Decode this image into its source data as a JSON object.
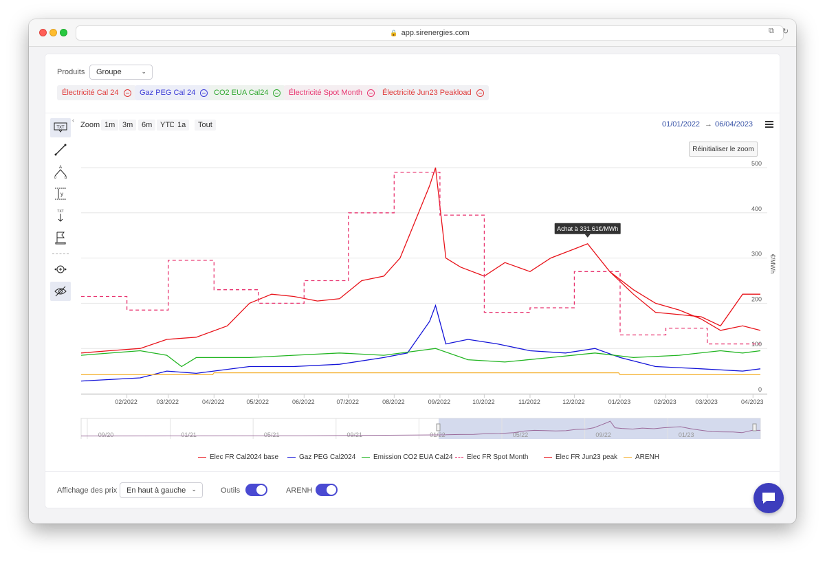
{
  "browser": {
    "url": "app.sirenergies.com"
  },
  "filters": {
    "products_label": "Produits",
    "group_value": "Groupe",
    "tags": [
      {
        "label": "Électricité Cal 24",
        "color": "#e03a3a",
        "bg": "#f1f1f4"
      },
      {
        "label": "Gaz PEG Cal 24",
        "color": "#3a3ad6",
        "bg": "#eceef8"
      },
      {
        "label": "CO2 EUA Cal24",
        "color": "#2fa82f",
        "bg": "#eef3ee"
      },
      {
        "label": "Électricité Spot Month",
        "color": "#e8336f",
        "bg": "#f5eef1"
      },
      {
        "label": "Électricité Jun23 Peakload",
        "color": "#e03a3a",
        "bg": "#f1f1f4"
      }
    ]
  },
  "toolbar": {
    "zoom_label": "Zoom",
    "zoom_buttons": [
      "1m",
      "3m",
      "6m",
      "YTD",
      "1a",
      "Tout"
    ],
    "range_from": "01/01/2022",
    "range_arrow": "→",
    "range_to": "06/04/2023",
    "reset_zoom": "Réinitialiser le zoom",
    "tools": [
      "text-label-icon",
      "line-icon",
      "triangle-abc-icon",
      "measure-y-icon",
      "text-arrow-icon",
      "flag-icon",
      "zoom-pan-icon",
      "hide-eye-icon"
    ]
  },
  "chart_data": {
    "type": "line",
    "x_ticks": [
      "02/2022",
      "03/2022",
      "04/2022",
      "05/2022",
      "06/2022",
      "07/2022",
      "08/2022",
      "09/2022",
      "10/2022",
      "11/2022",
      "12/2022",
      "01/2023",
      "02/2023",
      "03/2023",
      "04/2023"
    ],
    "y_ticks": [
      "0",
      "100",
      "200",
      "300",
      "400",
      "500"
    ],
    "ylabel": "€/MWh",
    "ylim": [
      0,
      500
    ],
    "xlim": [
      "2022-01-01",
      "2023-04-06"
    ],
    "tooltip": "Achat à 331.61€/MWh",
    "navigator_ticks": [
      "09/20",
      "01/21",
      "05/21",
      "09/21",
      "01/22",
      "05/22",
      "09/22",
      "01/23"
    ],
    "series": [
      {
        "name": "Elec FR Cal2024 base",
        "color": "#e8131a",
        "dash": false,
        "x": [
          "2022-01-01",
          "2022-01-20",
          "2022-02-10",
          "2022-02-28",
          "2022-03-20",
          "2022-04-10",
          "2022-04-25",
          "2022-05-10",
          "2022-05-25",
          "2022-06-10",
          "2022-06-25",
          "2022-07-10",
          "2022-07-25",
          "2022-08-05",
          "2022-08-15",
          "2022-08-25",
          "2022-08-29",
          "2022-09-05",
          "2022-09-15",
          "2022-10-01",
          "2022-10-15",
          "2022-11-01",
          "2022-11-15",
          "2022-12-01",
          "2022-12-10",
          "2022-12-25",
          "2023-01-10",
          "2023-01-25",
          "2023-02-10",
          "2023-02-25",
          "2023-03-10",
          "2023-03-25",
          "2023-04-06"
        ],
        "y": [
          90,
          95,
          100,
          120,
          125,
          150,
          200,
          220,
          215,
          205,
          210,
          250,
          260,
          300,
          380,
          460,
          500,
          300,
          280,
          260,
          290,
          270,
          300,
          320,
          331.61,
          270,
          220,
          180,
          175,
          170,
          150,
          220,
          220
        ]
      },
      {
        "name": "Gaz PEG Cal2024",
        "color": "#1414d8",
        "dash": false,
        "x": [
          "2022-01-01",
          "2022-02-10",
          "2022-02-28",
          "2022-03-20",
          "2022-04-25",
          "2022-05-25",
          "2022-06-25",
          "2022-07-25",
          "2022-08-10",
          "2022-08-25",
          "2022-08-29",
          "2022-09-05",
          "2022-09-20",
          "2022-10-10",
          "2022-11-01",
          "2022-11-25",
          "2022-12-15",
          "2023-01-01",
          "2023-01-25",
          "2023-02-25",
          "2023-03-25",
          "2023-04-06"
        ],
        "y": [
          28,
          35,
          50,
          45,
          60,
          60,
          65,
          80,
          90,
          160,
          195,
          110,
          120,
          110,
          95,
          90,
          100,
          80,
          60,
          55,
          50,
          55
        ]
      },
      {
        "name": "Emission CO2 EUA Cal24",
        "color": "#22b522",
        "dash": false,
        "x": [
          "2022-01-01",
          "2022-02-10",
          "2022-02-28",
          "2022-03-10",
          "2022-03-20",
          "2022-04-25",
          "2022-05-25",
          "2022-06-25",
          "2022-07-25",
          "2022-08-29",
          "2022-09-20",
          "2022-10-15",
          "2022-11-15",
          "2022-12-15",
          "2023-01-10",
          "2023-02-10",
          "2023-03-10",
          "2023-03-25",
          "2023-04-06"
        ],
        "y": [
          85,
          95,
          85,
          60,
          80,
          80,
          85,
          90,
          85,
          100,
          75,
          70,
          80,
          90,
          80,
          85,
          95,
          90,
          95
        ]
      },
      {
        "name": "Elec FR Spot Month",
        "color": "#e8336f",
        "dash": true,
        "x": [
          "2022-01-01",
          "2022-02-01",
          "2022-03-01",
          "2022-04-01",
          "2022-05-01",
          "2022-06-01",
          "2022-07-01",
          "2022-08-01",
          "2022-09-01",
          "2022-10-01",
          "2022-11-01",
          "2022-12-01",
          "2023-01-01",
          "2023-02-01",
          "2023-03-01",
          "2023-04-01",
          "2023-04-06"
        ],
        "y": [
          215,
          185,
          295,
          230,
          200,
          250,
          400,
          490,
          395,
          180,
          190,
          270,
          130,
          145,
          110,
          110,
          110
        ]
      },
      {
        "name": "Elec FR Jun23 peak",
        "color": "#e8131a",
        "dash": false,
        "x": [
          "2022-12-25",
          "2023-01-10",
          "2023-01-25",
          "2023-02-10",
          "2023-02-25",
          "2023-03-10",
          "2023-03-25",
          "2023-04-06"
        ],
        "y": [
          270,
          230,
          200,
          185,
          165,
          140,
          150,
          140
        ]
      },
      {
        "name": "ARENH",
        "color": "#f5b233",
        "dash": false,
        "x": [
          "2022-01-01",
          "2022-03-31",
          "2022-04-01",
          "2022-12-31",
          "2023-01-01",
          "2023-04-06"
        ],
        "y": [
          42,
          42,
          46.2,
          46.2,
          42,
          42
        ]
      }
    ],
    "legend_position": "bottom"
  },
  "footer": {
    "price_display_label": "Affichage des prix",
    "price_display_value": "En haut à gauche",
    "tools_label": "Outils",
    "arenh_label": "ARENH"
  }
}
